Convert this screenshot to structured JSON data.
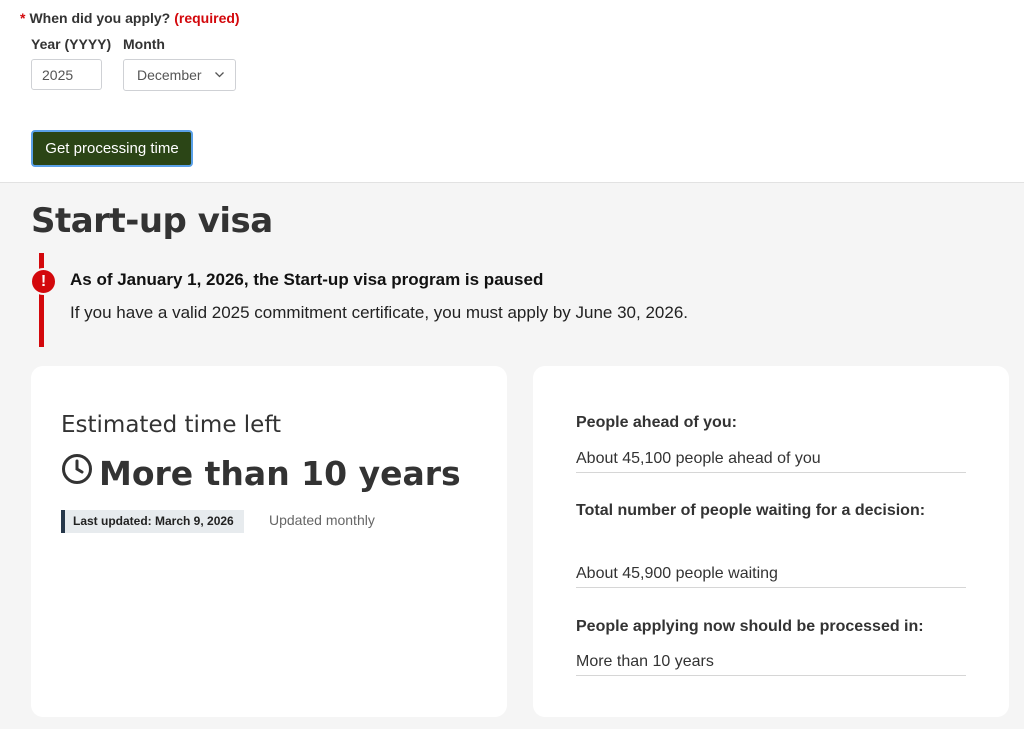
{
  "form": {
    "legend_star": "*",
    "legend": "When did you apply?",
    "required": "(required)",
    "year_label": "Year (YYYY)",
    "year_value": "2025",
    "month_label": "Month",
    "month_value": "December",
    "submit_label": "Get processing time"
  },
  "result": {
    "title": "Start-up visa",
    "alert": {
      "icon_glyph": "!",
      "title": "As of January 1, 2026, the Start-up visa program is paused",
      "body": "If you have a valid 2025 commitment certificate, you must apply by June 30, 2026."
    },
    "estimate": {
      "label": "Estimated time left",
      "value": "More than 10 years",
      "last_updated": "Last updated: March 9, 2026",
      "update_frequency": "Updated monthly"
    },
    "details": [
      {
        "label": "People ahead of you:",
        "value": "About 45,100 people ahead of you"
      },
      {
        "label": "Total number of people waiting for a decision:",
        "value": "About 45,900 people waiting"
      },
      {
        "label": "People applying now should be processed in:",
        "value": "More than 10 years"
      }
    ]
  },
  "colors": {
    "required_red": "#d3080c",
    "button_green": "#2b4516",
    "alert_red": "#d3080c",
    "panel_bg": "#f5f5f5"
  },
  "icons": {
    "alert": "exclamation-circle-icon",
    "clock": "clock-icon",
    "select_arrow": "chevron-down-icon"
  }
}
